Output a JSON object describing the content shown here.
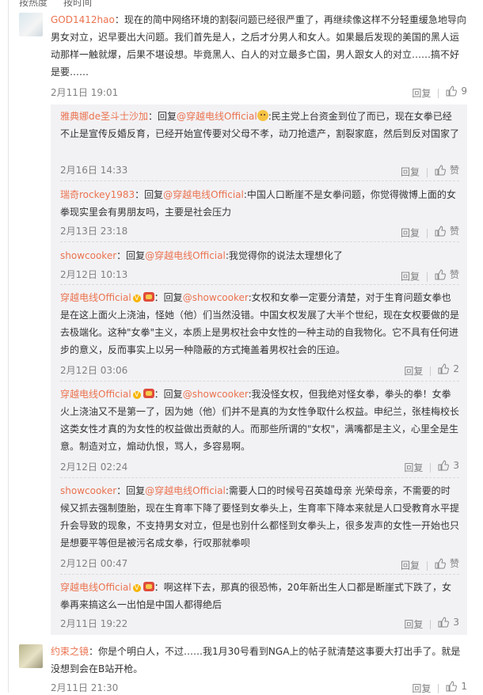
{
  "top_strip": {
    "left": "按热度",
    "right": "按时间"
  },
  "comments": [
    {
      "user": "GOD1412hao",
      "text": "：现在的简中网络环境的割裂问题已经很严重了，再继续像这样不分轻重缓急地导向男女对立，迟早要出大问题。我们首先是人，之后才分男人和女人。如果最后发现的美国的黑人运动那样一触就爆，后果不堪设想。毕竟黑人、白人的对立最多亡国，男人跟女人的对立……搞不好是要……",
      "time": "2月11日 19:01",
      "reply_label": "回复",
      "like_count": "9"
    },
    {
      "user": "约束之镜",
      "text": "：你是个明白人，不过……我1月30号看到NGA上的帖子就清楚这事要大打出手了。就是没想到会在B站开枪。",
      "time": "2月11日 21:30",
      "reply_label": "回复",
      "like_count": "1"
    }
  ],
  "replies": [
    {
      "user": "雅典娜de圣斗士沙加",
      "reply_prefix": "：回复",
      "mention": "@穿越电线Official",
      "text": ":民主党上台资金到位了而已，现在女拳已经不止是宣传反婚反育，已经开始宣传要对父母不孝，动刀抢遗产，割裂家庭，然后到反对国家了",
      "time": "2月16日 14:33",
      "reply_label": "回复",
      "like_label": "赞"
    },
    {
      "user": "瑞奇rockey1983",
      "reply_prefix": "：回复",
      "mention": "@穿越电线Official",
      "text": ":中国人口断崖不是女拳问题，你觉得微博上面的女拳现实里会有男朋友吗，主要是社会压力",
      "time": "2月13日 23:18",
      "reply_label": "回复",
      "like_label": "赞"
    },
    {
      "user": "showcooker",
      "reply_prefix": "：回复",
      "mention": "@穿越电线Official",
      "text": ":我觉得你的说法太理想化了",
      "time": "2月12日 10:13",
      "reply_label": "回复",
      "like_label": "赞"
    },
    {
      "user": "穿越电线Official",
      "reply_prefix": "：回复",
      "mention": "@showcooker",
      "text": ":女权和女拳一定要分清楚，对于生育问题女拳也是在这上面火上浇油，怪她（他）们当然没错。中国女权发展了大半个世纪，现在女权要做的是去极端化。这种\"女拳\"主义，本质上是男权社会中女性的一种主动的自我物化。它不具有任何进步的意义，反而事实上以另一种隐蔽的方式掩盖着男权社会的压迫。",
      "time": "2月12日 03:06",
      "reply_label": "回复",
      "like_count": "2"
    },
    {
      "user": "穿越电线Official",
      "reply_prefix": "：回复",
      "mention": "@showcooker",
      "text": ":我没怪女权，但我绝对怪女拳，拳头的拳！女拳火上浇油又不是第一了，因为她（他）们并不是真的为女性争取什么权益。申纪兰，张桂梅校长这类女性才真的为女性的权益做出贡献的人。而那些所谓的\"女权\"，满嘴都是主义，心里全是生意。制造对立，煽动仇恨，骂人，多容易啊。",
      "time": "2月12日 02:24",
      "reply_label": "回复",
      "like_count": "3"
    },
    {
      "user": "showcooker",
      "reply_prefix": "：回复",
      "mention": "@穿越电线Official",
      "text": ":需要人口的时候号召英雄母亲 光荣母亲，不需要的时候又抓去强制堕胎，现在生育率下降了要怪到女拳头上，生育率下降本来就是人口受教育水平提升会导致的现象，不支持男女对立，但是也别什么都怪到女拳头上，很多发声的女性一开始也只是想要平等但是被污名成女拳，行叹那就拳呗",
      "time": "2月12日 00:47",
      "reply_label": "回复",
      "like_label": "赞"
    },
    {
      "user": "穿越电线Official",
      "reply_prefix": "：",
      "mention": "",
      "text": "啊这样下去，那真的很恐怖，20年新出生人口都是断崖式下跌了，女拳再来搞这么一出怕是中国人都得绝后",
      "time": "2月11日 19:22",
      "reply_label": "回复",
      "like_count": "3"
    }
  ],
  "colors": {
    "name": "#eb7350",
    "meta": "#808080",
    "reply_bg": "#f2f2f5",
    "text": "#333333"
  }
}
